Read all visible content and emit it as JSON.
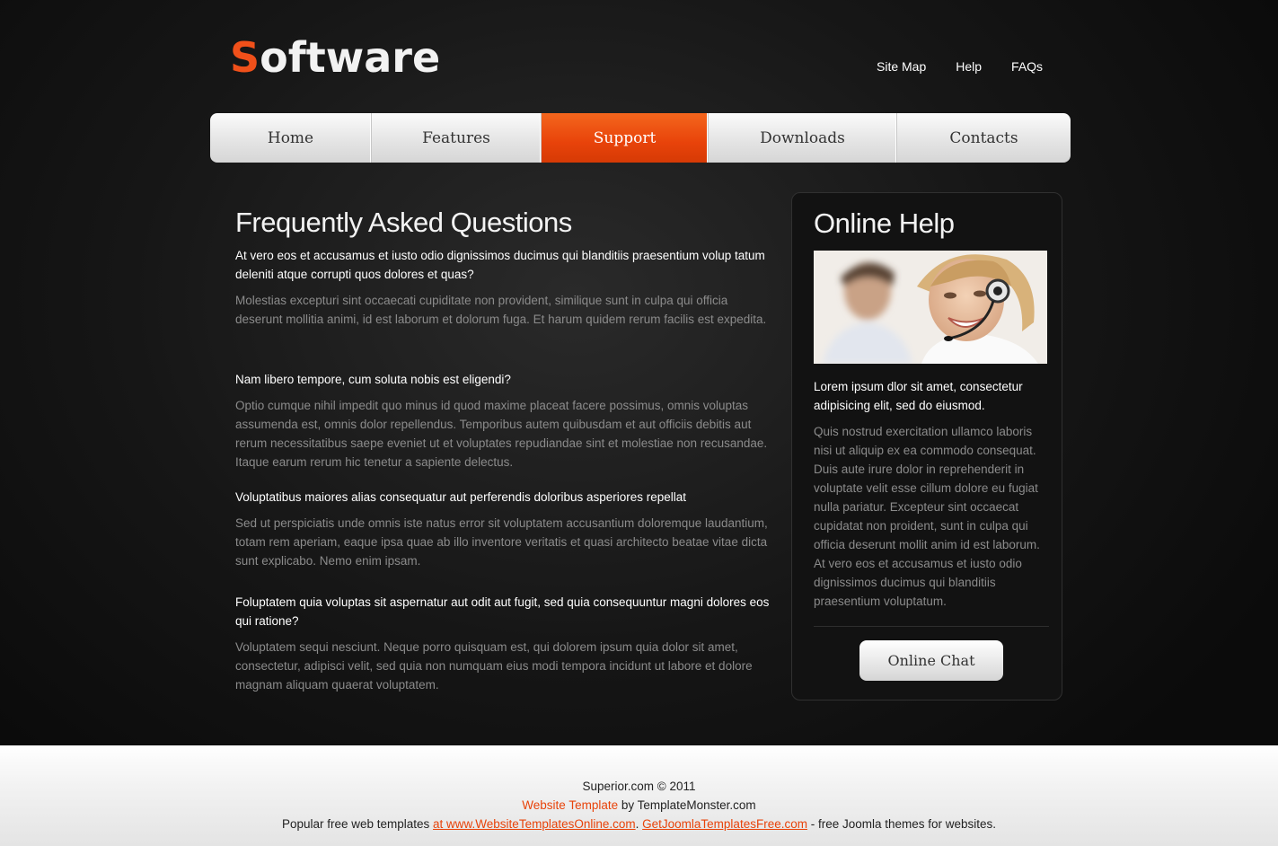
{
  "header": {
    "logo_first": "S",
    "logo_rest": "oftware",
    "links": [
      "Site Map",
      "Help",
      "FAQs"
    ]
  },
  "nav": {
    "items": [
      "Home",
      "Features",
      "Support",
      "Downloads",
      "Contacts"
    ],
    "active": "Support"
  },
  "main": {
    "title": "Frequently Asked Questions",
    "faqs": [
      {
        "q": "At vero eos et accusamus et iusto odio dignissimos ducimus qui blanditiis praesentium volup tatum deleniti atque corrupti quos dolores et quas?",
        "a": "Molestias excepturi sint occaecati cupiditate non provident, similique sunt in culpa qui officia deserunt mollitia animi, id est laborum et dolorum fuga. Et harum quidem rerum facilis est expedita."
      },
      {
        "q": "Nam libero tempore, cum soluta nobis est eligendi?",
        "a": "Optio cumque nihil impedit quo minus id quod maxime placeat facere possimus, omnis voluptas assumenda est, omnis dolor repellendus. Temporibus autem quibusdam et aut officiis debitis aut rerum necessitatibus saepe eveniet ut et voluptates repudiandae sint et molestiae non recusandae. Itaque earum rerum hic tenetur a sapiente delectus."
      },
      {
        "q": "Voluptatibus maiores alias consequatur aut perferendis doloribus asperiores repellat",
        "a": "Sed ut perspiciatis unde omnis iste natus error sit voluptatem accusantium doloremque laudantium, totam rem aperiam, eaque ipsa quae ab illo inventore veritatis et quasi architecto beatae vitae dicta sunt explicabo. Nemo enim ipsam."
      },
      {
        "q": "Foluptatem quia voluptas sit aspernatur aut odit aut fugit, sed quia consequuntur magni dolores eos qui ratione?",
        "a": "Voluptatem sequi nesciunt. Neque porro quisquam est, qui dolorem ipsum quia dolor sit amet, consectetur, adipisci velit, sed quia non numquam eius modi tempora incidunt ut labore et dolore magnam aliquam quaerat voluptatem."
      }
    ]
  },
  "sidebar": {
    "title": "Online Help",
    "lead": "Lorem ipsum dlor sit amet, consectetur adipisicing elit, sed do eiusmod.",
    "body": "Quis nostrud exercitation ullamco laboris nisi ut aliquip ex ea commodo consequat. Duis aute irure dolor in reprehenderit in voluptate velit esse cillum dolore eu fugiat nulla pariatur. Excepteur sint occaecat cupidatat non proident, sunt in culpa qui officia deserunt mollit anim id est laborum. At vero eos et accusamus et iusto odio dignissimos ducimus qui blanditiis praesentium voluptatum.",
    "button": "Online Chat"
  },
  "footer": {
    "line1": "Superior.com © 2011",
    "line2_link": "Website Template",
    "line2_rest": " by TemplateMonster.com",
    "line3_start": "Popular free web templates ",
    "line3_link1": "at www.WebsiteTemplatesOnline.com",
    "line3_mid": ". ",
    "line3_link2": "GetJoomlaTemplatesFree.com",
    "line3_end": " - free Joomla themes for websites."
  },
  "colors": {
    "accent": "#e8430a",
    "background": "#111111",
    "text_muted": "#8b8b8b"
  }
}
